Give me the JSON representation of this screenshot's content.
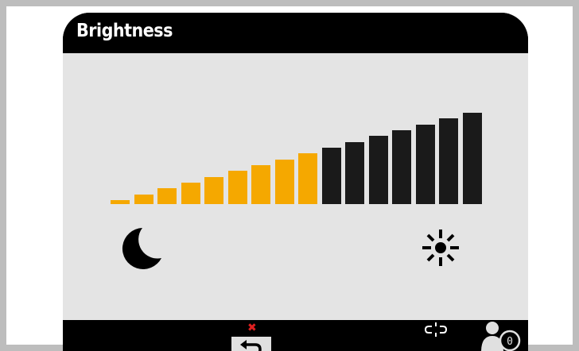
{
  "screen": {
    "title": "Brightness"
  },
  "brightness": {
    "level": 9,
    "max_level": 16,
    "active_color": "#f5a800",
    "inactive_color": "#1a1a1a"
  },
  "icons": {
    "low": "moon-icon",
    "high": "sun-icon",
    "back": "back-arrow-icon",
    "cancel": "close-icon",
    "link": "link-broken-icon",
    "profile": "user-profile-icon"
  },
  "profile": {
    "badge": "0"
  }
}
